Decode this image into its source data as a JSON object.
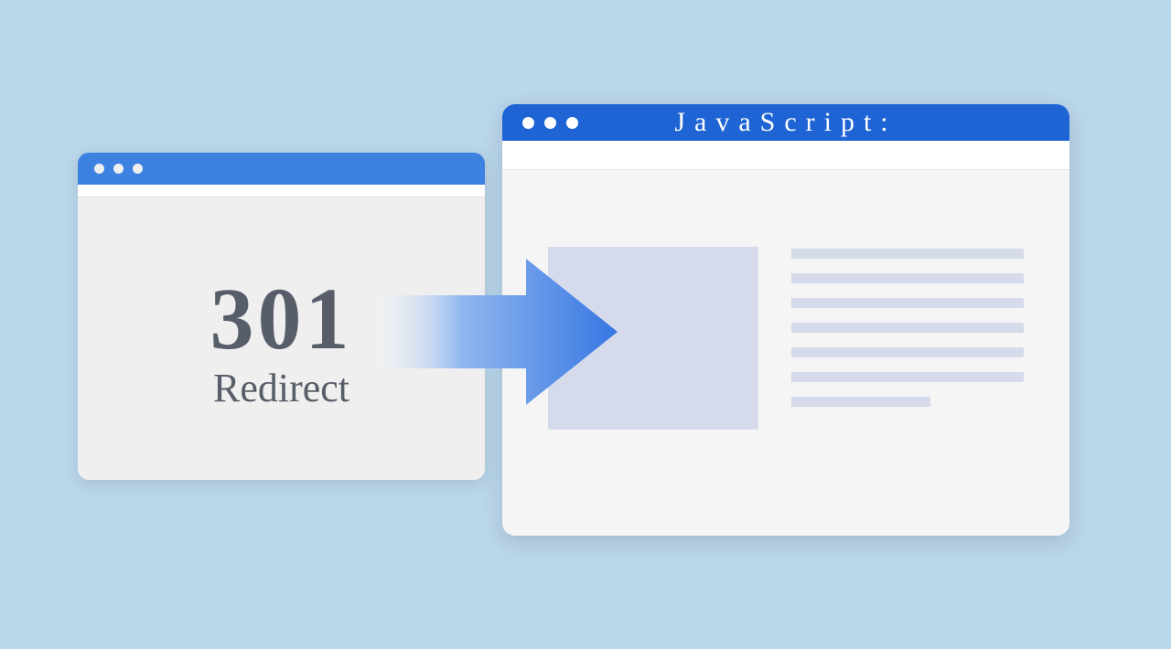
{
  "left_window": {
    "code": "301",
    "label": "Redirect"
  },
  "right_window": {
    "title": "JavaScript:"
  },
  "colors": {
    "background": "#bbd7ec",
    "titlebar_left": "#3d82e1",
    "titlebar_right": "#1e64d4",
    "arrow_start": "#eef3fb",
    "arrow_end": "#3777e3",
    "placeholder": "#d6dbec",
    "text": "#575e69"
  }
}
